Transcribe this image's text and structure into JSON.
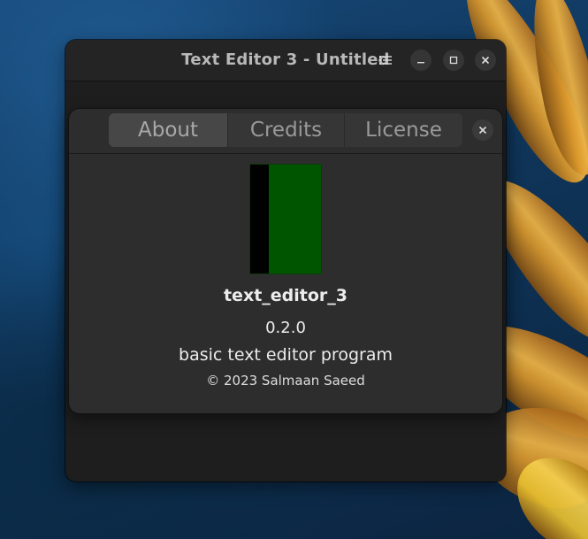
{
  "window": {
    "title": "Text Editor 3 - Untitled",
    "buttons": {
      "menu_icon": "list-icon",
      "minimize_icon": "minimize-icon",
      "maximize_icon": "maximize-icon",
      "close_icon": "close-icon"
    }
  },
  "about_dialog": {
    "tabs": [
      {
        "label": "About",
        "active": true
      },
      {
        "label": "Credits",
        "active": false
      },
      {
        "label": "License",
        "active": false
      }
    ],
    "close_icon": "close-icon",
    "app_name": "text_editor_3",
    "version": "0.2.0",
    "description": "basic text editor program",
    "copyright": "© 2023 Salmaan Saeed",
    "logo_colors": {
      "bar": "#000000",
      "fill": "#005500"
    }
  },
  "colors": {
    "window_bg": "#1e1e1e",
    "dialog_bg": "#2d2d2d",
    "accent_wallpaper_orange": "#f0b545",
    "accent_wallpaper_blue": "#17497a"
  }
}
